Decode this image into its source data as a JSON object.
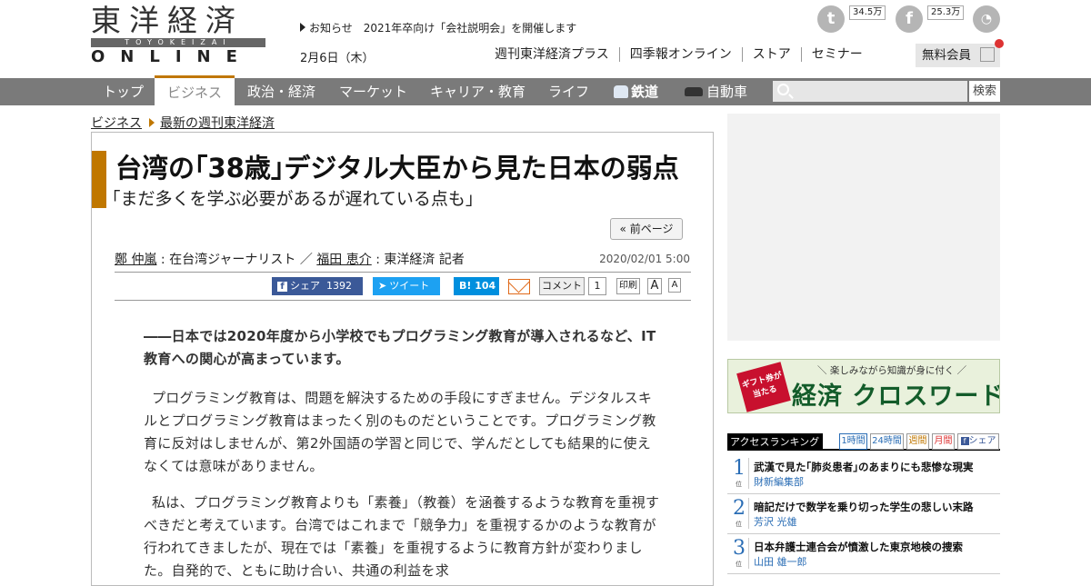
{
  "header": {
    "logo_kanji": "東洋経済",
    "logo_latin": "TOYOKEIZAI",
    "logo_online": "ONLINE",
    "notice": "お知らせ　2021年卒向け「会社説明会」を開催します",
    "date": "2月6日（木）",
    "links": [
      "週刊東洋経済プラス",
      "四季報オンライン",
      "ストア",
      "セミナー"
    ],
    "member_button": "無料会員",
    "twitter_count": "34.5万",
    "facebook_count": "25.3万"
  },
  "nav": {
    "items": [
      "トップ",
      "ビジネス",
      "政治・経済",
      "マーケット",
      "キャリア・教育",
      "ライフ",
      "鉄道",
      "自動車"
    ],
    "active": "ビジネス",
    "search_button": "検索"
  },
  "breadcrumb": [
    "ビジネス",
    "最新の週刊東洋経済"
  ],
  "article": {
    "title": "台湾の｢38歳｣デジタル大臣から見た日本の弱点",
    "subtitle": "｢まだ多くを学ぶ必要があるが遅れている点も｣",
    "prev_page": "« 前ページ",
    "author1_name": "鄭 仲嵐",
    "author1_role": "在台湾ジャーナリスト",
    "author2_name": "福田 恵介",
    "author2_role": "東洋経済 記者",
    "author_sep": "／",
    "published": "2020/02/01 5:00",
    "share": {
      "facebook": "シェア",
      "facebook_count": "1392",
      "twitter": "ツイート",
      "hatena": "B!",
      "hatena_count": "104",
      "comment": "コメント",
      "comment_count": "1",
      "print": "印刷",
      "font_large": "A",
      "font_small": "A"
    },
    "lead": "――日本では2020年度から小学校でもプログラミング教育が導入されるなど、IT教育への関心が高まっています。",
    "paragraphs": [
      "プログラミング教育は、問題を解決するための手段にすぎません。デジタルスキルとプログラミング教育はまったく別のものだということです。プログラミング教育に反対はしませんが、第2外国語の学習と同じで、学んだとしても結果的に使えなくては意味がありません。",
      "私は、プログラミング教育よりも「素養」（教養）を涵養するような教育を重視すべきだと考えています。台湾ではこれまで「競争力」を重視するかのような教育が行われてきましたが、現在では「素養」を重視するように教育方針が変わりました。自発的で、ともに助け合い、共通の利益を求"
    ]
  },
  "sidebar": {
    "banner_small": "＼ 楽しみながら知識が身に付く ／",
    "banner_big": "経済 クロスワード",
    "banner_badge": "ギフト券が当たる",
    "ranking_title": "アクセスランキング",
    "ranking_tabs": [
      "1時間",
      "24時間",
      "週間",
      "月間",
      "シェア"
    ],
    "ranking_unit": "位",
    "ranking": [
      {
        "num": "1",
        "title": "武漢で見た｢肺炎患者｣のあまりにも悲惨な現実",
        "author": "財新編集部"
      },
      {
        "num": "2",
        "title": "暗記だけで数学を乗り切った学生の悲しい末路",
        "author": "芳沢 光雄"
      },
      {
        "num": "3",
        "title": "日本弁護士連合会が憤激した東京地検の捜索",
        "author": "山田 雄一郎"
      }
    ]
  },
  "colors": {
    "accent": "#c07700",
    "nav_bg": "#7a7a7a",
    "link_blue": "#2a6db5",
    "facebook": "#3b5998",
    "twitter": "#1da1f2",
    "hatena": "#008fde"
  }
}
